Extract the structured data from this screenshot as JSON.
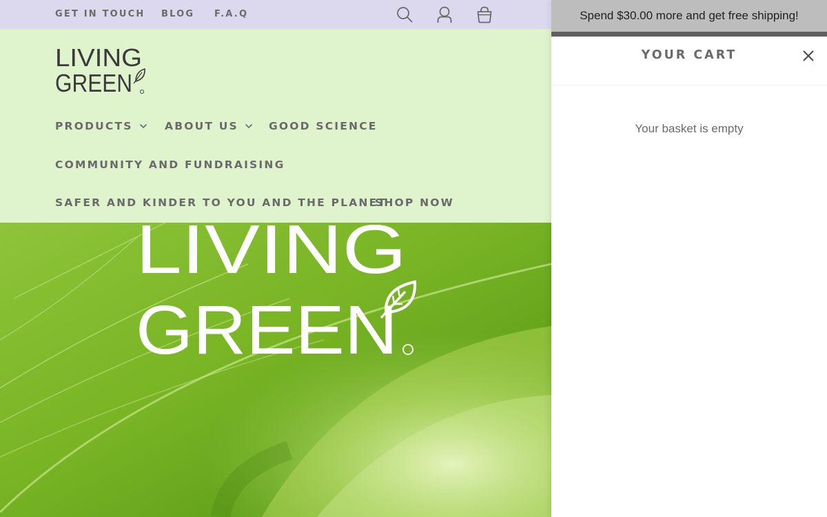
{
  "topbar": {
    "links": [
      "GET IN TOUCH",
      "BLOG",
      "F.A.Q"
    ],
    "icons": [
      "search-icon",
      "account-icon",
      "cart-bag-icon"
    ]
  },
  "header": {
    "logo": {
      "line1": "LIVING",
      "line2": "GREEN"
    },
    "nav": [
      {
        "label": "PRODUCTS",
        "has_dropdown": true
      },
      {
        "label": "ABOUT US",
        "has_dropdown": true
      },
      {
        "label": "GOOD SCIENCE",
        "has_dropdown": false
      },
      {
        "label": "COMMUNITY AND FUNDRAISING",
        "has_dropdown": false
      },
      {
        "label": "SAFER AND KINDER TO YOU AND THE PLANET",
        "has_dropdown": false
      },
      {
        "label": "SHOP NOW",
        "has_dropdown": false
      }
    ]
  },
  "hero": {
    "logo": {
      "line1": "LIVING",
      "line2": "GREEN"
    }
  },
  "cart": {
    "shipping_message": "Spend $30.00 more and get free shipping!",
    "title": "YOUR CART",
    "empty_message": "Your basket is empty"
  },
  "colors": {
    "topbar_bg": "#dcd9ee",
    "header_bg": "#dff3cd",
    "nav_text": "#6a6a6a",
    "shipping_bar_bg": "#bdbdbd",
    "shipping_progress": "#5f5f5f",
    "hero_green": "#7fb82a"
  }
}
